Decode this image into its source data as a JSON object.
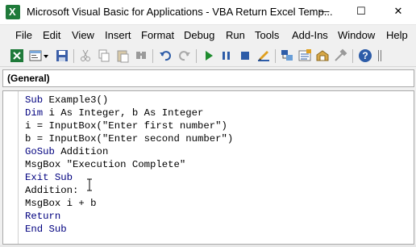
{
  "window": {
    "title": "Microsoft Visual Basic for Applications - VBA Return Excel Temp...",
    "minimize_glyph": "—",
    "maximize_glyph": "☐",
    "close_glyph": "✕"
  },
  "menu": {
    "items": [
      "File",
      "Edit",
      "View",
      "Insert",
      "Format",
      "Debug",
      "Run",
      "Tools",
      "Add-Ins",
      "Window",
      "Help"
    ]
  },
  "toolbar": {
    "icons": [
      "excel-view-icon",
      "insert-module-icon",
      "save-icon",
      "cut-icon",
      "copy-icon",
      "paste-icon",
      "find-icon",
      "undo-icon",
      "redo-icon",
      "run-icon",
      "break-icon",
      "reset-icon",
      "design-mode-icon",
      "project-explorer-icon",
      "properties-icon",
      "object-browser-icon",
      "toolbox-icon",
      "help-icon"
    ]
  },
  "object_dropdown": {
    "value": "(General)"
  },
  "code": {
    "lines": [
      {
        "indent": "",
        "keyword": "Sub",
        "text": " Example3()"
      },
      {
        "indent": "",
        "keyword": "Dim",
        "text": " i As Integer, b As Integer"
      },
      {
        "indent": "",
        "keyword": "",
        "text": "i = InputBox(\"Enter first number\")"
      },
      {
        "indent": "",
        "keyword": "",
        "text": "b = InputBox(\"Enter second number\")"
      },
      {
        "indent": "",
        "keyword": "GoSub",
        "text": " Addition"
      },
      {
        "indent": "",
        "keyword": "",
        "text": "MsgBox \"Execution Complete\""
      },
      {
        "indent": "",
        "keyword": "Exit Sub",
        "text": ""
      },
      {
        "indent": "",
        "keyword": "",
        "text": "Addition:"
      },
      {
        "indent": "",
        "keyword": "",
        "text": "MsgBox i + b"
      },
      {
        "indent": "",
        "keyword": "Return",
        "text": ""
      },
      {
        "indent": "",
        "keyword": "End Sub",
        "text": ""
      }
    ]
  },
  "colors": {
    "keyword": "#00007f",
    "text": "#000000",
    "background": "#f0f0f0"
  }
}
